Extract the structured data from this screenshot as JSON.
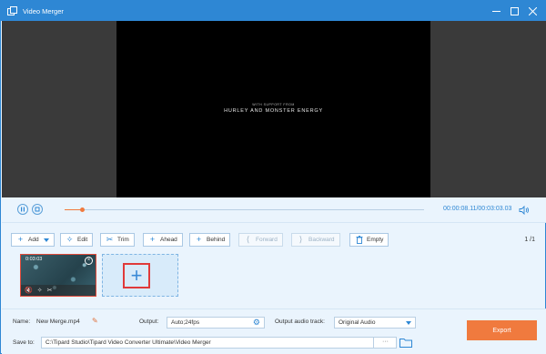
{
  "window": {
    "title": "Video Merger"
  },
  "preview": {
    "caption_small": "WITH SUPPORT FROM",
    "caption_main": "HURLEY AND MONSTER ENERGY"
  },
  "playback": {
    "current_time": "00:00:08.11",
    "total_time": "/00:03:03.03",
    "progress": 0.05
  },
  "toolbar": {
    "add": "Add",
    "edit": "Edit",
    "trim": "Trim",
    "ahead": "Ahead",
    "behind": "Behind",
    "forward": "Forward",
    "backward": "Backward",
    "empty": "Empty",
    "page": "1 /1"
  },
  "clips": [
    {
      "duration": "0:03:03 "
    }
  ],
  "bottom": {
    "name_label": "Name:",
    "name_value": "New Merge.mp4",
    "output_label": "Output:",
    "output_value": "Auto;24fps",
    "audio_label": "Output audio track:",
    "audio_value": "Original Audio",
    "save_label": "Save to:",
    "save_path": "C:\\Tipard Studio\\Tipard Video Converter Ultimate\\Video Merger",
    "browse": "···",
    "export": "Export"
  },
  "colors": {
    "accent": "#2e87d4",
    "export": "#f07a3e",
    "highlight": "#e03a3a"
  }
}
